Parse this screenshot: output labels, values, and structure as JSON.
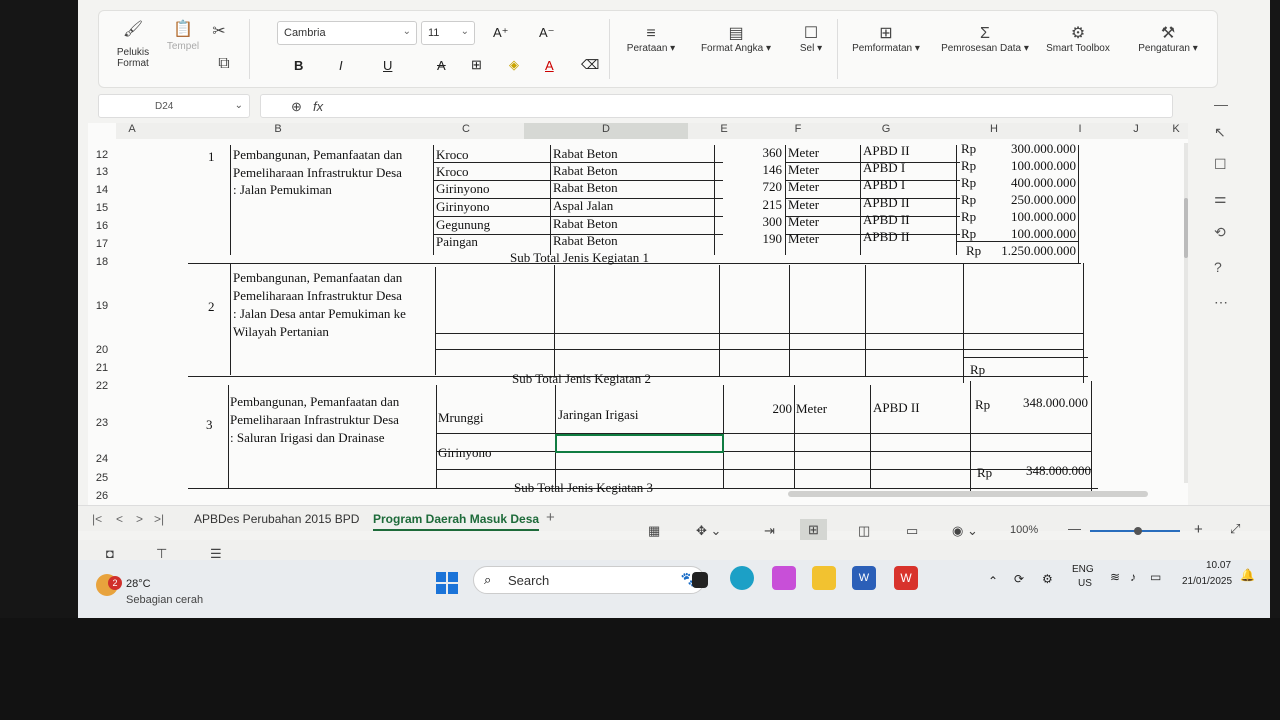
{
  "ribbon": {
    "paint_format": [
      "Pelukis",
      "Format"
    ],
    "paste": "Tempel",
    "font_name": "Cambria",
    "font_size": "11",
    "bold": "B",
    "italic": "I",
    "underline": "U",
    "groups": [
      "Perataan",
      "Format Angka",
      "Sel",
      "Pemformatan",
      "Pemrosesan Data",
      "Smart Toolbox",
      "Pengaturan"
    ]
  },
  "formula_bar": {
    "name_box": "D24",
    "fx": "fx"
  },
  "columns": [
    "A",
    "B",
    "C",
    "D",
    "E",
    "F",
    "G",
    "H",
    "I",
    "J",
    "K"
  ],
  "rows": {
    "r12": "12",
    "r13": "13",
    "r14": "14",
    "r15": "15",
    "r16": "16",
    "r17": "17",
    "r18": "18",
    "r19": "19",
    "r20": "20",
    "r21": "21",
    "r22": "22",
    "r23": "23",
    "r24": "24",
    "r25": "25",
    "r26": "26"
  },
  "block1": {
    "no": "1",
    "activity": [
      "Pembangunan, Pemanfaatan dan",
      "Pemeliharaan Infrastruktur Desa",
      ": Jalan Pemukiman"
    ],
    "items": [
      {
        "loc": "Kroco",
        "type": "Rabat Beton",
        "vol": "360",
        "unit": "Meter",
        "src": "APBD II",
        "rp": "Rp",
        "amount": "300.000.000"
      },
      {
        "loc": "Kroco",
        "type": "Rabat Beton",
        "vol": "146",
        "unit": "Meter",
        "src": "APBD I",
        "rp": "Rp",
        "amount": "100.000.000"
      },
      {
        "loc": "Girinyono",
        "type": "Rabat Beton",
        "vol": "720",
        "unit": "Meter",
        "src": "APBD I",
        "rp": "Rp",
        "amount": "400.000.000"
      },
      {
        "loc": "Girinyono",
        "type": "Aspal Jalan",
        "vol": "215",
        "unit": "Meter",
        "src": "APBD II",
        "rp": "Rp",
        "amount": "250.000.000"
      },
      {
        "loc": "Gegunung",
        "type": "Rabat Beton",
        "vol": "300",
        "unit": "Meter",
        "src": "APBD II",
        "rp": "Rp",
        "amount": "100.000.000"
      },
      {
        "loc": "Paingan",
        "type": "Rabat Beton",
        "vol": "190",
        "unit": "Meter",
        "src": "APBD II",
        "rp": "Rp",
        "amount": "100.000.000"
      }
    ],
    "subtotal_label": "Sub Total Jenis Kegiatan 1",
    "subtotal_rp": "Rp",
    "subtotal_amount": "1.250.000.000"
  },
  "block2": {
    "no": "2",
    "activity": [
      "Pembangunan, Pemanfaatan dan",
      "Pemeliharaan Infrastruktur Desa",
      ": Jalan Desa antar Pemukiman ke",
      "Wilayah Pertanian"
    ],
    "subtotal_label": "Sub Total Jenis Kegiatan 2",
    "subtotal_rp": "Rp"
  },
  "block3": {
    "no": "3",
    "activity": [
      "Pembangunan, Pemanfaatan dan",
      "Pemeliharaan Infrastruktur Desa",
      ": Saluran Irigasi dan Drainase"
    ],
    "loc1": "Mrunggi",
    "type1": "Jaringan Irigasi",
    "vol1": "200",
    "unit1": "Meter",
    "src1": "APBD II",
    "rp1": "Rp",
    "amount1": "348.000.000",
    "loc2": "Girinyono",
    "subtotal_label": "Sub Total Jenis Kegiatan 3",
    "subtotal_rp": "Rp",
    "subtotal_amount": "348.000.000"
  },
  "sheet_tabs": [
    "APBDes Perubahan 2015 BPD",
    "Program Daerah Masuk Desa"
  ],
  "zoom": "100%",
  "taskbar": {
    "weather_temp": "28°C",
    "weather_desc": "Sebagian cerah",
    "weather_badge": "2",
    "search": "Search",
    "lang": "ENG",
    "region": "US",
    "time": "10.07",
    "date": "21/01/2025"
  },
  "colors": {
    "accent": "#1e6b3a",
    "selection": "#107c41"
  }
}
